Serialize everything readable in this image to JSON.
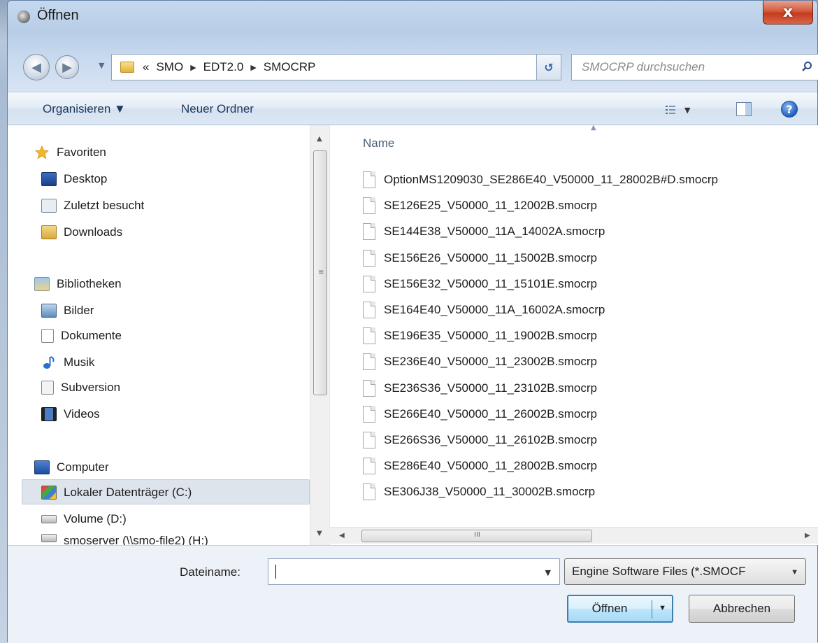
{
  "window": {
    "title": "Öffnen",
    "close_label": "x"
  },
  "address": {
    "overflow": "«",
    "crumbs": [
      "SMO",
      "EDT2.0",
      "SMOCRP"
    ]
  },
  "search": {
    "placeholder": "SMOCRP durchsuchen"
  },
  "toolbar": {
    "organize": "Organisieren ▼",
    "new_folder": "Neuer Ordner"
  },
  "nav": {
    "favorites_header": "Favoriten",
    "favorites": [
      "Desktop",
      "Zuletzt besucht",
      "Downloads"
    ],
    "libraries_header": "Bibliotheken",
    "libraries": [
      "Bilder",
      "Dokumente",
      "Musik",
      "Subversion",
      "Videos"
    ],
    "computer_header": "Computer",
    "drives": [
      "Lokaler Datenträger (C:)",
      "Volume (D:)",
      "smoserver (\\\\smo-file2) (H:)"
    ]
  },
  "files": {
    "column_name": "Name",
    "items": [
      "OptionMS1209030_SE286E40_V50000_11_28002B#D.smocrp",
      "SE126E25_V50000_11_12002B.smocrp",
      "SE144E38_V50000_11A_14002A.smocrp",
      "SE156E26_V50000_11_15002B.smocrp",
      "SE156E32_V50000_11_15101E.smocrp",
      "SE164E40_V50000_11A_16002A.smocrp",
      "SE196E35_V50000_11_19002B.smocrp",
      "SE236E40_V50000_11_23002B.smocrp",
      "SE236S36_V50000_11_23102B.smocrp",
      "SE266E40_V50000_11_26002B.smocrp",
      "SE266S36_V50000_11_26102B.smocrp",
      "SE286E40_V50000_11_28002B.smocrp",
      "SE306J38_V50000_11_30002B.smocrp"
    ]
  },
  "bottom": {
    "filename_label": "Dateiname:",
    "filename_value": "",
    "filetype": "Engine Software Files (*.SMOCF",
    "open_button": "Öffnen",
    "cancel_button": "Abbrechen"
  }
}
